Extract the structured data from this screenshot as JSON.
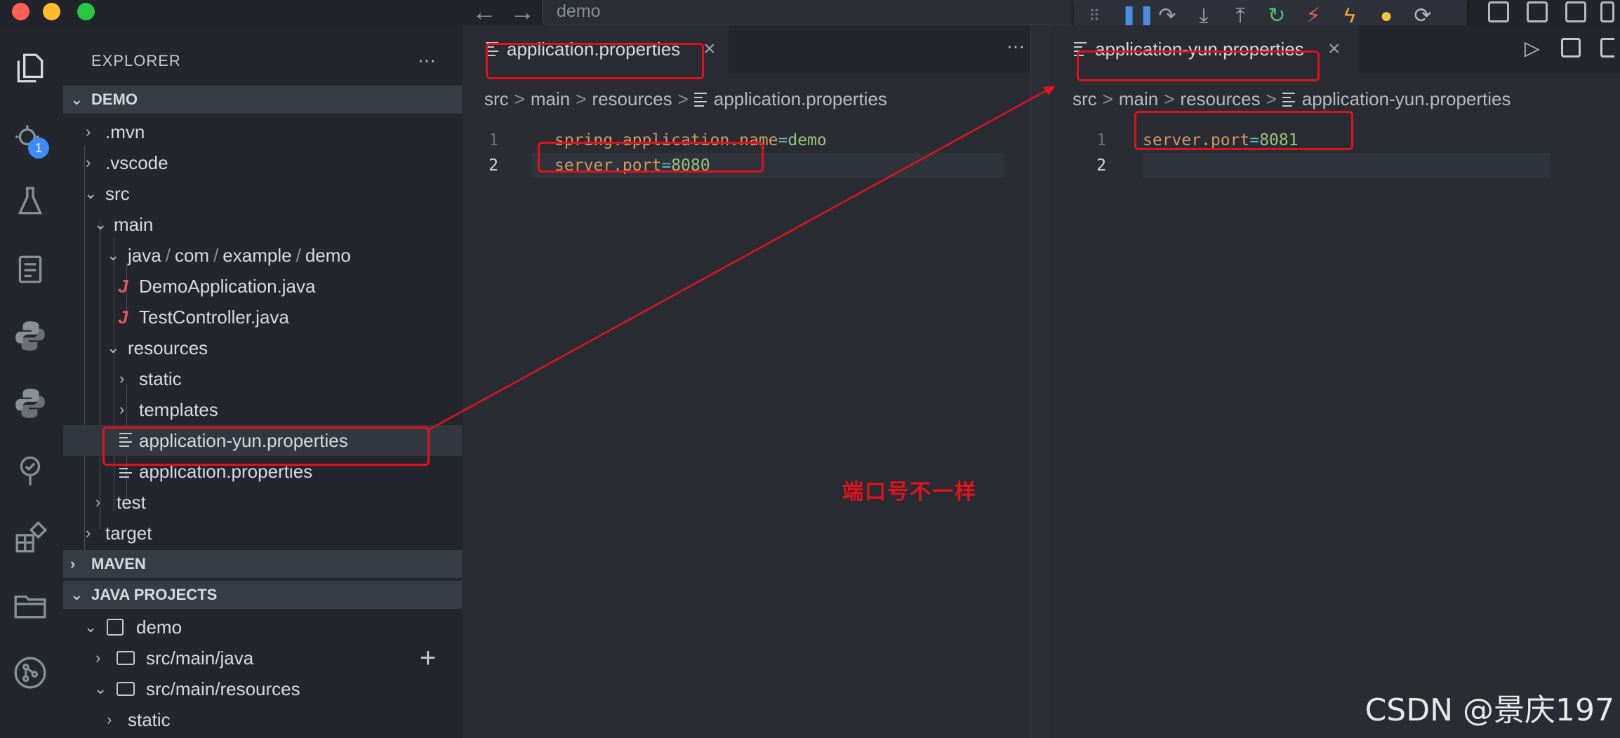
{
  "titlebar": {
    "search_text": "demo",
    "back_icon": "arrow-left-icon",
    "forward_icon": "arrow-right-icon"
  },
  "activity_bar": {
    "icons": [
      "explorer-icon",
      "run-debug-icon",
      "testing-icon",
      "clipboard-icon",
      "python-icon",
      "python-icon",
      "tree-icon",
      "extensions-icon",
      "folder-icon",
      "source-control-icon"
    ],
    "debug_badge": "1"
  },
  "sidebar": {
    "title": "EXPLORER",
    "more": "···",
    "demo_section": "DEMO",
    "maven_section": "MAVEN",
    "java_projects_section": "JAVA PROJECTS",
    "tree": {
      "mvn": ".mvn",
      "vscode": ".vscode",
      "src": "src",
      "main": "main",
      "java_path": [
        "java",
        "com",
        "example",
        "demo"
      ],
      "java_sep": "/",
      "demo_app": "DemoApplication.java",
      "test_controller": "TestController.java",
      "java_file_icon": "J",
      "resources": "resources",
      "static": "static",
      "templates": "templates",
      "app_yun": "application-yun.properties",
      "app_props": "application.properties",
      "test": "test",
      "target": "target"
    },
    "java_projects": {
      "demo": "demo",
      "src_main_java": "src/main/java",
      "src_main_resources": "src/main/resources",
      "static": "static",
      "add": "+"
    }
  },
  "left_editor": {
    "tab_label": "application.properties",
    "close": "×",
    "more": "···",
    "breadcrumb": [
      "src",
      "main",
      "resources",
      "application.properties"
    ],
    "breadcrumb_sep": ">",
    "lines": [
      {
        "num": "1",
        "key": "spring.application.name",
        "eq": "=",
        "val": "demo"
      },
      {
        "num": "2",
        "key": "server.port",
        "eq": "=",
        "val": "8080"
      }
    ]
  },
  "right_editor": {
    "tab_label": "application-yun.properties",
    "close": "×",
    "breadcrumb": [
      "src",
      "main",
      "resources",
      "application-yun.properties"
    ],
    "breadcrumb_sep": ">",
    "lines": [
      {
        "num": "1",
        "key": "server.port",
        "eq": "=",
        "val": "8081"
      },
      {
        "num": "2",
        "key": "",
        "eq": "",
        "val": ""
      }
    ]
  },
  "annotation": {
    "note": "端口号不一样",
    "color": "#e0121c"
  },
  "watermark": "CSDN @景庆197",
  "colors": {
    "key": "#d19a66",
    "value": "#98c379",
    "java_icon": "#e0555a",
    "badge": "#3d8bfd"
  }
}
